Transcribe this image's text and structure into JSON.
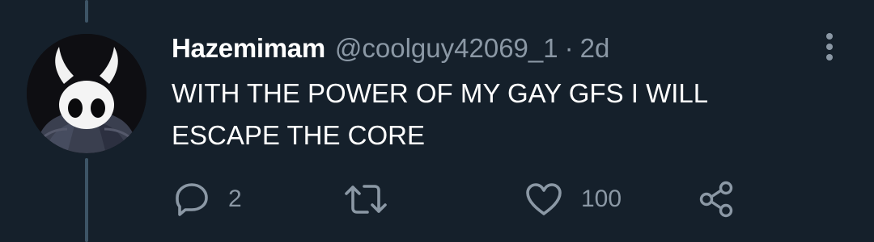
{
  "tweet": {
    "display_name": "Hazemimam",
    "handle": "@coolguy42069_1",
    "separator": "·",
    "time": "2d",
    "text": "WITH THE POWER OF MY GAY GFS I WILL\nESCAPE THE CORE"
  },
  "actions": {
    "reply_count": "2",
    "retweet_count": "",
    "like_count": "100"
  },
  "colors": {
    "background": "#15202b",
    "text": "#ffffff",
    "secondary": "#8b98a5",
    "thread_line": "#3d5466"
  },
  "icons": {
    "reply": "speech-bubble",
    "retweet": "retweet-arrows",
    "like": "heart-outline",
    "share": "share-nodes",
    "more": "vertical-dots"
  }
}
